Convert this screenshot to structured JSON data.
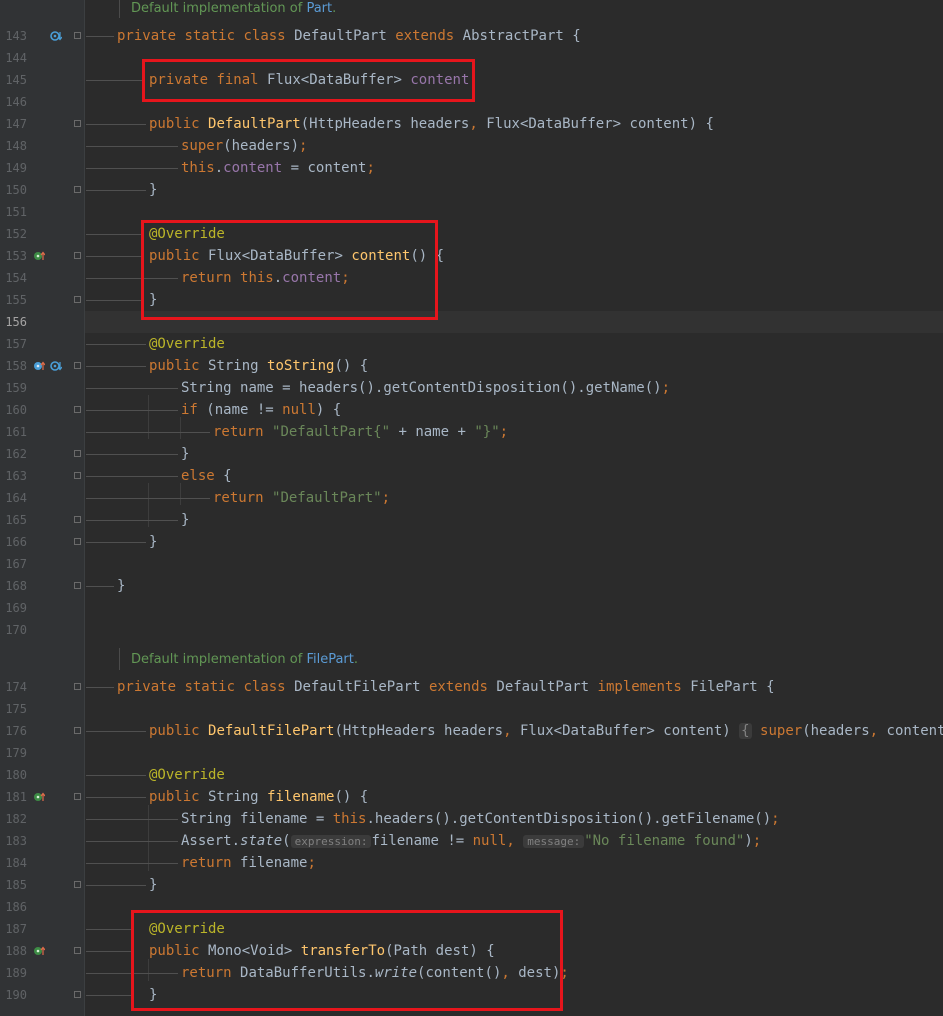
{
  "editor": {
    "doc_comments": {
      "default_part": {
        "prefix": "Default implementation of ",
        "link": "Part",
        "suffix": "."
      },
      "default_file_part": {
        "prefix": "Default implementation of ",
        "link": "FilePart",
        "suffix": "."
      }
    },
    "line_numbers": {
      "l143": "143",
      "l144": "144",
      "l145": "145",
      "l146": "146",
      "l147": "147",
      "l148": "148",
      "l149": "149",
      "l150": "150",
      "l151": "151",
      "l152": "152",
      "l153": "153",
      "l154": "154",
      "l155": "155",
      "l156": "156",
      "l157": "157",
      "l158": "158",
      "l159": "159",
      "l160": "160",
      "l161": "161",
      "l162": "162",
      "l163": "163",
      "l164": "164",
      "l165": "165",
      "l166": "166",
      "l167": "167",
      "l168": "168",
      "l169": "169",
      "l170": "170",
      "l174": "174",
      "l175": "175",
      "l176": "176",
      "l179": "179",
      "l180": "180",
      "l181": "181",
      "l182": "182",
      "l183": "183",
      "l184": "184",
      "l185": "185",
      "l186": "186",
      "l187": "187",
      "l188": "188",
      "l189": "189",
      "l190": "190"
    },
    "tokens": {
      "private": "private",
      "static": "static",
      "class": "class",
      "final": "final",
      "public": "public",
      "extends": "extends",
      "implements": "implements",
      "super": "super",
      "this": "this",
      "return": "return",
      "if": "if",
      "else": "else",
      "null": "null",
      "DefaultPart": "DefaultPart",
      "AbstractPart": "AbstractPart",
      "DefaultFilePart": "DefaultFilePart",
      "FilePart": "FilePart",
      "Flux": "Flux",
      "DataBuffer": "DataBuffer",
      "HttpHeaders": "HttpHeaders",
      "String": "String",
      "Mono": "Mono",
      "Void": "Void",
      "Path": "Path",
      "DataBufferUtils": "DataBufferUtils",
      "Assert": "Assert",
      "content": "content",
      "headers": "headers",
      "name": "name",
      "filename": "filename",
      "dest": "dest",
      "getContentDisposition": "getContentDisposition",
      "getName": "getName",
      "getFilename": "getFilename",
      "toString": "toString",
      "transferTo": "transferTo",
      "write": "write",
      "state": "state",
      "Override": "@Override",
      "str_defaultpart_open": "\"DefaultPart{\"",
      "str_close": "\"}\"",
      "str_defaultpart": "\"DefaultPart\"",
      "str_no_filename": "\"No filename found\"",
      "hint_expression": "expression:",
      "hint_message": "message:",
      "lt": "<",
      "gt": ">",
      "lp": "(",
      "rp": ")",
      "lb": "{",
      "rb": "}",
      "semi": ";",
      "comma": ",",
      "dot": ".",
      "eq": " = ",
      "plus": " + ",
      "neq": " != ",
      "sp": " "
    }
  },
  "colors": {
    "keyword": "#cc7832",
    "field": "#9876aa",
    "method": "#ffc66d",
    "annotation": "#bbb529",
    "string": "#6a8759",
    "highlight_box": "#e6151c"
  }
}
